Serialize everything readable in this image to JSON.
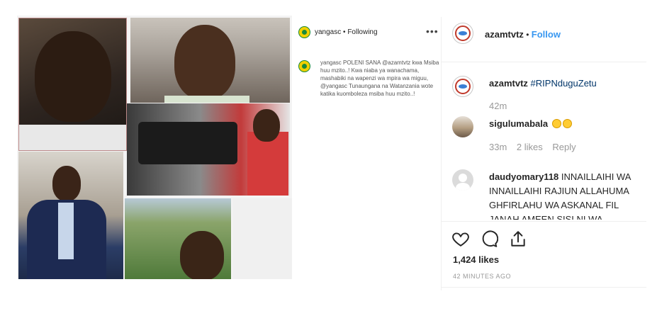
{
  "post_image": {
    "alt_present": true
  },
  "caption": {
    "header_user": "yangasc",
    "header_sep": " • ",
    "header_status": "Following",
    "more_label": "•••",
    "body_user": "yangasc",
    "body_text": "POLENI SANA @azamtvtz kwa Msiba huu mzito..! Kwa niaba ya wanachama, mashabiki na wapenzi wa mpira wa miguu, @yangasc Tunaungana na Watanzania wote katika kuomboleza msiba huu mzito..!"
  },
  "header": {
    "username": "azamtvtz",
    "sep": " • ",
    "follow_label": "Follow"
  },
  "comments": [
    {
      "user": "azamtvtz",
      "text": "#RIPNduguZetu",
      "time": "42m",
      "likes": "",
      "reply": ""
    },
    {
      "user": "sigulumabala",
      "text": "",
      "emoji_count": 2,
      "time": "33m",
      "likes": "2 likes",
      "reply": "Reply"
    },
    {
      "user": "daudyomary118",
      "text": "INNAILLAIHI WA INNAILLAIHI RAJIUN ALLAHUMA GHFIRLAHU WA ASKANAL FIL JANAH AMEEN SISI NI WA"
    }
  ],
  "actions": {
    "like_icon": "heart-icon",
    "comment_icon": "comment-icon",
    "share_icon": "share-icon"
  },
  "likes_count": "1,424 likes",
  "timestamp": "42 MINUTES AGO",
  "colors": {
    "follow": "#3897f0",
    "muted": "#999999",
    "text": "#262626",
    "divider": "#efefef"
  }
}
